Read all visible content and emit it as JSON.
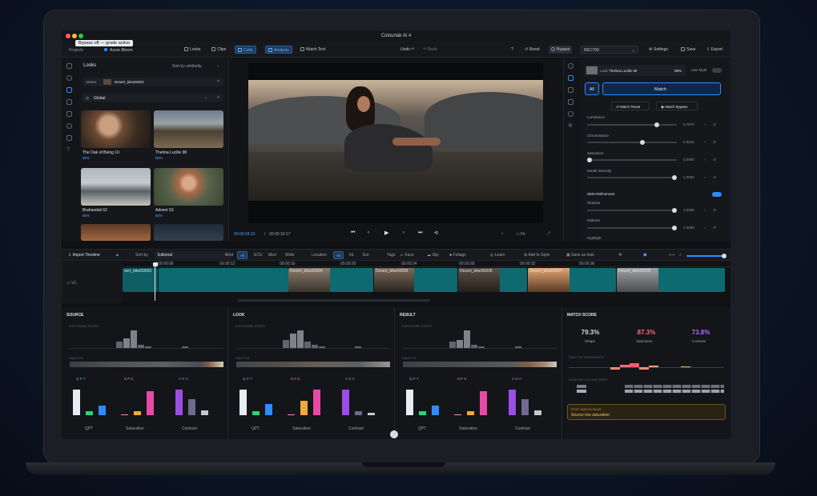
{
  "app": {
    "title": "Colourlab Ai 4",
    "breadcrumb_projects": "Projects",
    "project": "Azure Bloom",
    "tooltip": "Bypass off — grade active"
  },
  "toolbar": {
    "looks": "Looks",
    "clips": "Clips",
    "color": "Color",
    "analysis": "Analysis",
    "match_text": "Match Text",
    "undo": "Undo",
    "redo": "Redo",
    "reset": "Reset",
    "bypass": "Bypass",
    "preset": "REC709",
    "settings": "Settings",
    "save": "Save",
    "export": "Export"
  },
  "looks_panel": {
    "title": "Looks",
    "sort": "Sort by similarity",
    "starter_label": "Starter",
    "starter_value": "Desert_bike00003",
    "scope": "Global",
    "items": [
      {
        "name": "The Oak of Being 10",
        "score": "89%"
      },
      {
        "name": "Thelma Lucille 98",
        "score": "88%"
      },
      {
        "name": "Brahandali 62",
        "score": "86%"
      },
      {
        "name": "Advent 53",
        "score": "85%"
      }
    ]
  },
  "viewer": {
    "timecode": "00:00:04:13",
    "duration": "00:00:19:17",
    "zoom": "Fit"
  },
  "match_panel": {
    "look_label": "Look",
    "look_name": "Thelma Lucille 98",
    "look_score": "88%",
    "use_style": "Use Style",
    "all": "All",
    "match": "Match",
    "match_reset": "Match Reset",
    "match_bypass": "Match Bypass",
    "sliders": [
      {
        "name": "Luminance",
        "value": "0.7872"
      },
      {
        "name": "Chrominance",
        "value": "0.5242"
      },
      {
        "name": "Saturation",
        "value": "0.0000"
      },
      {
        "name": "Model Intensity",
        "value": "1.0000"
      }
    ],
    "refinement": "SMH Refinement",
    "refine_sliders": [
      {
        "name": "Shadow",
        "value": "1.0000"
      },
      {
        "name": "Midtone",
        "value": "1.0000"
      },
      {
        "name": "Highlight",
        "value": ""
      }
    ]
  },
  "timeline_bar": {
    "import": "Import Timeline",
    "sort_label": "Sort by",
    "sort_value": "Editorial",
    "shot": "Shot",
    "all": "All",
    "ecu": "ECU",
    "med": "Med",
    "wide": "Wide",
    "location": "Location",
    "int": "Int",
    "ext": "Ext",
    "tags": "Tags",
    "face": "Face",
    "sky": "Sky",
    "foliage": "Foliage",
    "learn": "Learn",
    "add_style": "Add to Style",
    "save_look": "Save as look"
  },
  "timeline": {
    "ruler": [
      "00:00:08",
      "00:00:12",
      "00:00:16",
      "00:00:20",
      "00:00:24",
      "00:00:28",
      "00:00:32",
      "00:00:36"
    ],
    "track": "V1",
    "clips": [
      "sert_bike00003",
      "Desert_bike00004",
      "Desert_bike00006",
      "Desert_bike00006",
      "Desert_bike00007",
      "Desert_bike00008"
    ]
  },
  "analysis": {
    "source": "SOURCE",
    "look": "LOOK",
    "result": "RESULT",
    "match_score": "MATCH SCORE",
    "exposure": "EXPOSURE STOPS",
    "palette": "PALETTE",
    "qpt": "QPT",
    "saturation": "Saturation",
    "contrast": "Contrast",
    "scores": [
      {
        "value": "79.3%",
        "label": "Shape",
        "color": "#dfe4ec"
      },
      {
        "value": "87.3%",
        "label": "Saturation",
        "color": "#ff6b7a"
      },
      {
        "value": "73.8%",
        "label": "Contrast",
        "color": "#b06bff"
      }
    ],
    "palette_diff": "PALETTE DIFFERENCE",
    "colour_shift": "SHADOW COLOUR SHIFT",
    "rule_title": "POST MATCH RULE",
    "rule_text": "Source low saturation"
  },
  "colors": {
    "accent": "#2d8cff",
    "teal": "#0d6a70"
  }
}
